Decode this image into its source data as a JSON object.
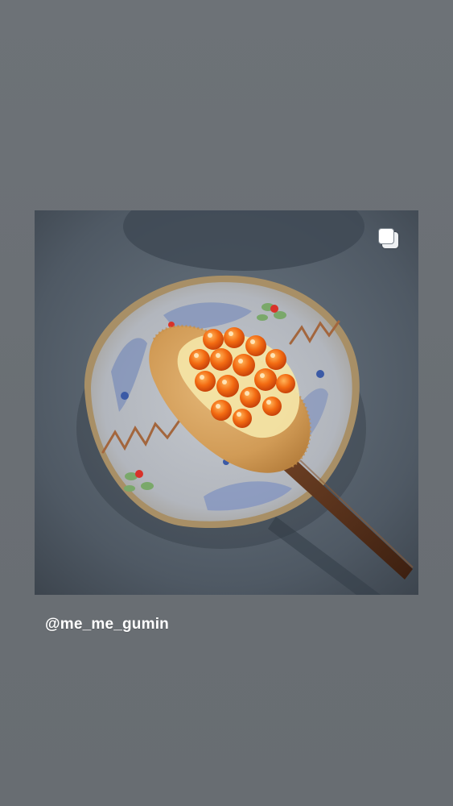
{
  "post": {
    "username": "@me_me_gumin",
    "icon": "multiple-photos-icon"
  },
  "colors": {
    "background": "#6c7176",
    "username_text": "#ffffff"
  }
}
